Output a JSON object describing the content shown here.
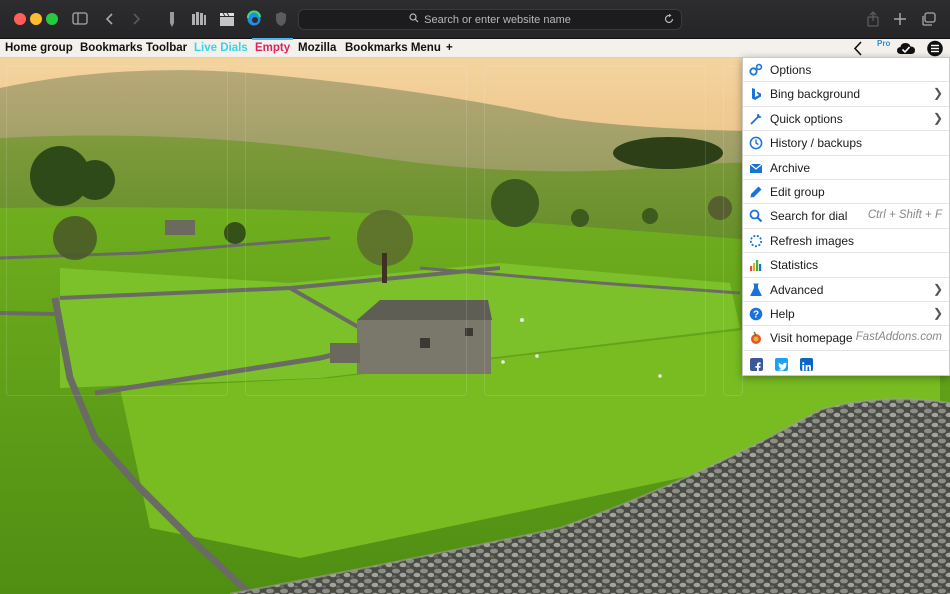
{
  "browser": {
    "url_placeholder": "Search or enter website name"
  },
  "bookmarks_bar": {
    "items": [
      {
        "label": "Home group"
      },
      {
        "label": "Bookmarks Toolbar"
      },
      {
        "label": "Live Dials"
      },
      {
        "label": "Empty"
      },
      {
        "label": "Mozilla"
      },
      {
        "label": "Bookmarks Menu"
      },
      {
        "label": "+"
      }
    ],
    "pro_badge": "Pro"
  },
  "menu": {
    "items": [
      {
        "label": "Options",
        "icon": "gears-icon",
        "submenu": false,
        "shortcut": ""
      },
      {
        "label": "Bing background",
        "icon": "bing-icon",
        "submenu": true,
        "shortcut": ""
      },
      {
        "label": "Quick options",
        "icon": "wrench-icon",
        "submenu": true,
        "shortcut": ""
      },
      {
        "label": "History / backups",
        "icon": "history-icon",
        "submenu": false,
        "shortcut": ""
      },
      {
        "label": "Archive",
        "icon": "archive-icon",
        "submenu": false,
        "shortcut": ""
      },
      {
        "label": "Edit group",
        "icon": "pencil-icon",
        "submenu": false,
        "shortcut": ""
      },
      {
        "label": "Search for dial",
        "icon": "search-icon",
        "submenu": false,
        "shortcut": "Ctrl + Shift + F"
      },
      {
        "label": "Refresh images",
        "icon": "refresh-icon",
        "submenu": false,
        "shortcut": ""
      },
      {
        "label": "Statistics",
        "icon": "bar-chart-icon",
        "submenu": false,
        "shortcut": ""
      },
      {
        "label": "Advanced",
        "icon": "flask-icon",
        "submenu": true,
        "shortcut": ""
      },
      {
        "label": "Help",
        "icon": "help-icon",
        "submenu": true,
        "shortcut": ""
      },
      {
        "label": "Visit homepage",
        "icon": "fastaddons-icon",
        "submenu": false,
        "shortcut": "FastAddons.com"
      }
    ],
    "social": [
      "facebook-icon",
      "twitter-icon",
      "linkedin-icon"
    ]
  },
  "colors": {
    "live_dials": "#37d5ea",
    "empty_tab": "#e0225e",
    "menu_icon_blue": "#1a73d9"
  }
}
